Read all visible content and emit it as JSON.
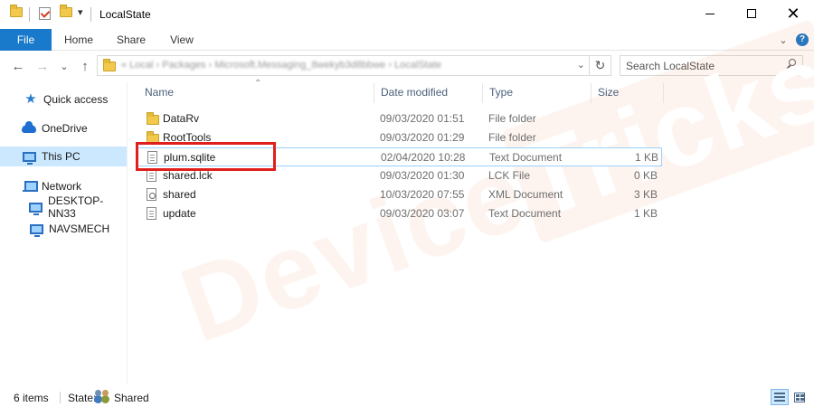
{
  "window": {
    "title": "LocalState",
    "minimize_icon": "minimize-icon",
    "maximize_icon": "maximize-icon",
    "close_icon": "close-icon"
  },
  "ribbon": {
    "tabs": [
      {
        "label": "File"
      },
      {
        "label": "Home"
      },
      {
        "label": "Share"
      },
      {
        "label": "View"
      }
    ],
    "expand_icon": "chevron-down-icon",
    "help_label": "?"
  },
  "address": {
    "path": "« Local › Packages › Microsoft.Messaging_8wekyb3d8bbwe › LocalState",
    "search_placeholder": "Search LocalState"
  },
  "nav_pane": {
    "items": [
      {
        "label": "Quick access",
        "icon": "star-icon"
      },
      {
        "label": "OneDrive",
        "icon": "cloud-icon"
      },
      {
        "label": "This PC",
        "icon": "computer-icon",
        "selected": true
      },
      {
        "label": "Network",
        "icon": "network-icon"
      },
      {
        "label": "DESKTOP-NN33",
        "icon": "computer-icon"
      },
      {
        "label": "NAVSMECH",
        "icon": "computer-icon"
      }
    ]
  },
  "file_list": {
    "columns": [
      "Name",
      "Date modified",
      "Type",
      "Size"
    ],
    "rows": [
      {
        "name": "DataRv",
        "date": "09/03/2020 01:51",
        "type": "File folder",
        "size": "",
        "icon": "folder-icon"
      },
      {
        "name": "RootTools",
        "date": "09/03/2020 01:29",
        "type": "File folder",
        "size": "",
        "icon": "folder-icon"
      },
      {
        "name": "plum.sqlite",
        "date": "02/04/2020 10:28",
        "type": "Text Document",
        "size": "1 KB",
        "icon": "text-document-icon",
        "highlighted": true
      },
      {
        "name": "shared.lck",
        "date": "09/03/2020 01:30",
        "type": "LCK File",
        "size": "0 KB",
        "icon": "file-icon"
      },
      {
        "name": "shared",
        "date": "10/03/2020 07:55",
        "type": "XML Document",
        "size": "3 KB",
        "icon": "xml-document-icon"
      },
      {
        "name": "update",
        "date": "09/03/2020 03:07",
        "type": "Text Document",
        "size": "1 KB",
        "icon": "text-document-icon"
      }
    ]
  },
  "status_bar": {
    "item_count": "6 items",
    "state_label": "State:",
    "state_value": "Shared"
  },
  "watermark": {
    "part1": "Device",
    "part2": "Tricks"
  },
  "colors": {
    "accent": "#1979ca",
    "selection": "#cce8ff",
    "highlight_box": "#e0201c",
    "watermark": "#e86e32"
  }
}
